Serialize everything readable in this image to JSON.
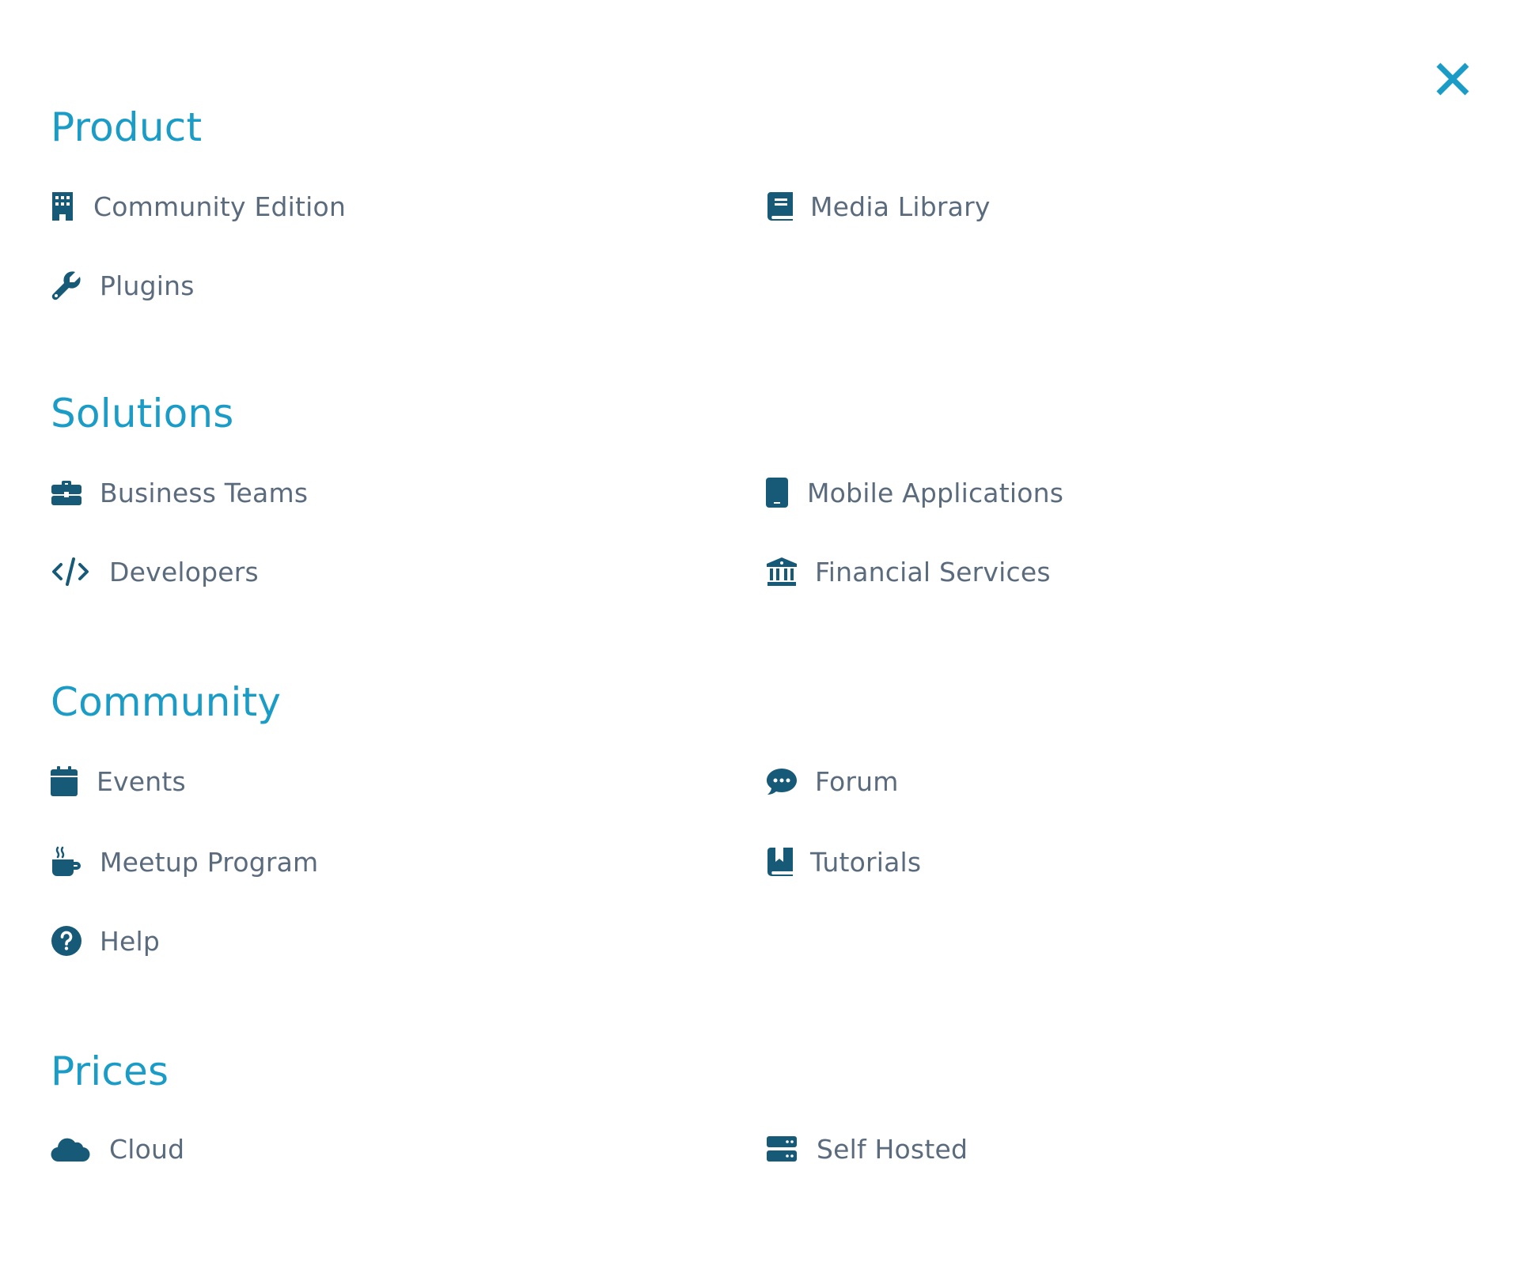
{
  "colors": {
    "accent": "#1a9cc7",
    "icon": "#175a78",
    "label": "#5b6b7e",
    "background": "#ffffff"
  },
  "close": {
    "icon": "close-icon"
  },
  "sections": [
    {
      "title": "Product",
      "items": [
        {
          "label": "Community Edition",
          "icon": "building-icon"
        },
        {
          "label": "Media Library",
          "icon": "book-icon"
        },
        {
          "label": "Plugins",
          "icon": "wrench-icon"
        }
      ]
    },
    {
      "title": "Solutions",
      "items": [
        {
          "label": "Business Teams",
          "icon": "briefcase-icon"
        },
        {
          "label": "Mobile Applications",
          "icon": "mobile-icon"
        },
        {
          "label": "Developers",
          "icon": "code-icon"
        },
        {
          "label": "Financial Services",
          "icon": "bank-icon"
        }
      ]
    },
    {
      "title": "Community",
      "items": [
        {
          "label": "Events",
          "icon": "calendar-icon"
        },
        {
          "label": "Forum",
          "icon": "chat-bubble-icon"
        },
        {
          "label": "Meetup Program",
          "icon": "coffee-icon"
        },
        {
          "label": "Tutorials",
          "icon": "bookmark-book-icon"
        },
        {
          "label": "Help",
          "icon": "question-circle-icon"
        }
      ]
    },
    {
      "title": "Prices",
      "items": [
        {
          "label": "Cloud",
          "icon": "cloud-icon"
        },
        {
          "label": "Self Hosted",
          "icon": "server-icon"
        }
      ]
    }
  ]
}
